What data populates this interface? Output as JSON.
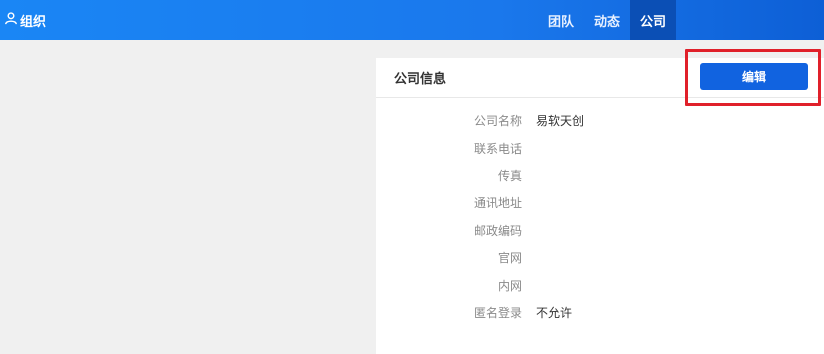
{
  "header": {
    "brand_label": "组织",
    "nav": [
      {
        "label": "团队",
        "active": false
      },
      {
        "label": "动态",
        "active": false
      },
      {
        "label": "公司",
        "active": true
      }
    ]
  },
  "company_card": {
    "title": "公司信息",
    "edit_label": "编辑",
    "fields": [
      {
        "label": "公司名称",
        "value": "易软天创"
      },
      {
        "label": "联系电话",
        "value": ""
      },
      {
        "label": "传真",
        "value": ""
      },
      {
        "label": "通讯地址",
        "value": ""
      },
      {
        "label": "邮政编码",
        "value": ""
      },
      {
        "label": "官网",
        "value": ""
      },
      {
        "label": "内网",
        "value": ""
      },
      {
        "label": "匿名登录",
        "value": "不允许"
      }
    ]
  },
  "colors": {
    "header_gradient_start": "#1a86f5",
    "header_gradient_end": "#0d5fd6",
    "nav_active_bg": "#0b4fb5",
    "primary_button": "#1163e0",
    "highlight_border": "#e0202a",
    "page_bg": "#f0f0f0"
  }
}
